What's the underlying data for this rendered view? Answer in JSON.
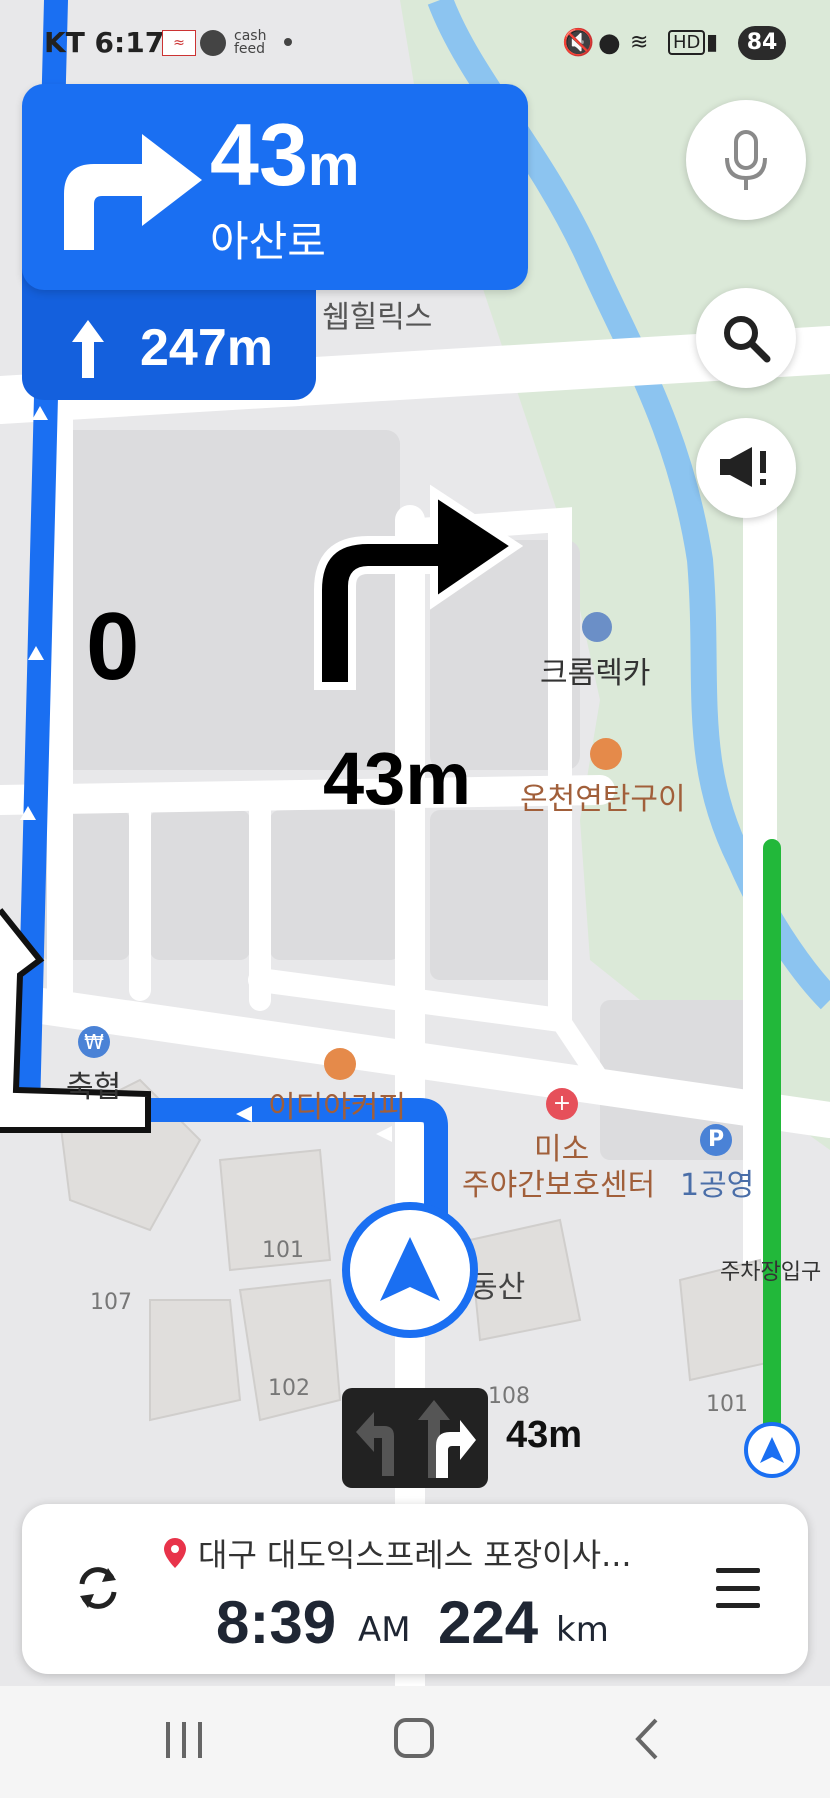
{
  "status_bar": {
    "carrier_time": "KT 6:17",
    "battery": "84"
  },
  "maneuver": {
    "distance": "43",
    "unit": "m",
    "road": "아산로",
    "next_distance": "247m"
  },
  "map": {
    "speed": "0",
    "hud_distance": "43m",
    "labels": {
      "wellhills": "쉡힐릭스",
      "chromeca": "크롬렉카",
      "oncheon": "온천연탄구이",
      "nh": "축협",
      "ediya": "이디야커피",
      "miso_1": "미소",
      "miso_2": "주야간보호센터",
      "parking": "1공영",
      "dong": "동산",
      "parking_entrance": "주차장입구",
      "h101a": "101",
      "h107": "107",
      "h102": "102",
      "h108": "108",
      "h101b": "101"
    }
  },
  "lane_guidance": {
    "distance": "43m"
  },
  "trip": {
    "destination": "대구 대도익스프레스 포장이사...",
    "eta": "8:39",
    "ampm": "AM",
    "remaining": "224",
    "remaining_unit": "km"
  },
  "colors": {
    "route_blue": "#1a6ff2",
    "progress_green": "#22b83a",
    "pin_red": "#e8334a"
  }
}
